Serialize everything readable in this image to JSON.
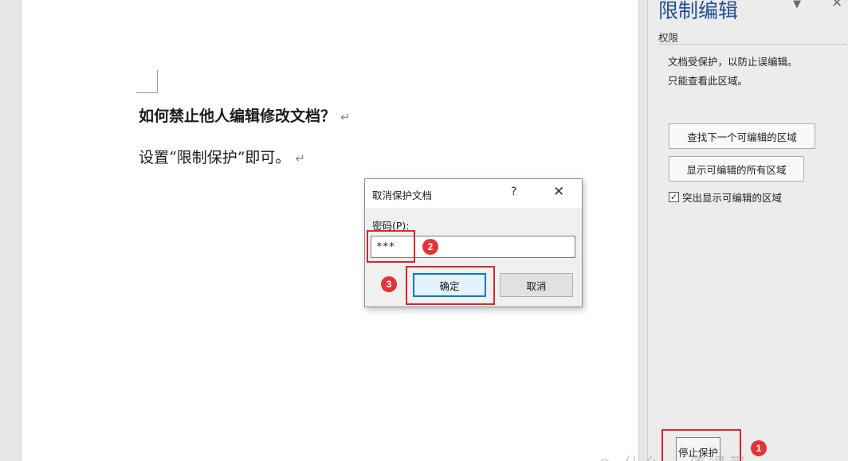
{
  "document": {
    "line1": "如何禁止他人编辑修改文档？",
    "line2": "设置“限制保护”即可。",
    "paragraph_mark": "↵"
  },
  "pane": {
    "title": "限制编辑",
    "menu_glyph": "▼",
    "close_glyph": "✕",
    "permissions_heading": "权限",
    "desc_line1": "文档受保护，以防止误编辑。",
    "desc_line2": "只能查看此区域。",
    "find_next_button": "查找下一个可编辑的区域",
    "show_all_button": "显示可编辑的所有区域",
    "highlight_checkbox_label": "突出显示可编辑的区域",
    "highlight_checked": true,
    "stop_protection_button": "停止保护"
  },
  "dialog": {
    "title": "取消保护文档",
    "help_glyph": "?",
    "close_glyph": "✕",
    "password_label": "密码(P):",
    "password_value": "***",
    "ok_button": "确定",
    "cancel_button": "取消"
  },
  "annotations": {
    "step1": "1",
    "step2": "2",
    "step3": "3",
    "highlight_color": "#e0242a"
  }
}
